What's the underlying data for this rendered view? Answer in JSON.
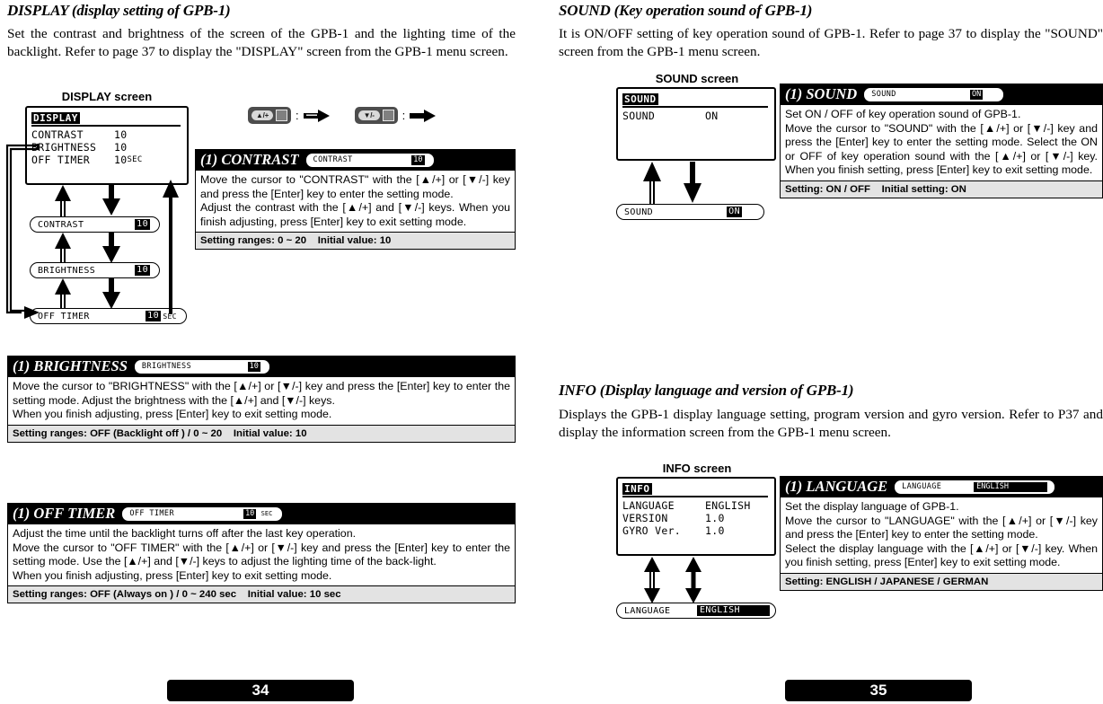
{
  "left_page": {
    "number": "34",
    "display_section": {
      "title": "DISPLAY (display setting of GPB-1)",
      "body": "Set the contrast and brightness of the screen of the GPB-1 and the lighting time of the backlight. Refer to page 37 to display the \"DISPLAY\" screen from the GPB-1 menu screen.",
      "screen_caption": "DISPLAY screen",
      "lcd": {
        "title": "DISPLAY",
        "rows": [
          {
            "label": "CONTRAST",
            "value": "10",
            "unit": ""
          },
          {
            "label": "BRIGHTNESS",
            "value": "10",
            "unit": ""
          },
          {
            "label": "OFF TIMER",
            "value": "10",
            "unit": "SEC"
          }
        ]
      },
      "flow_pills": [
        {
          "label": "CONTRAST",
          "value": "10",
          "suffix": ""
        },
        {
          "label": "BRIGHTNESS",
          "value": "10",
          "suffix": ""
        },
        {
          "label": "OFF TIMER",
          "value": "10",
          "suffix": "SEC"
        }
      ],
      "legend": [
        {
          "key": "/+",
          "arrow": "hollow-right-arrow",
          "colon": ":"
        },
        {
          "key": "/-",
          "arrow": "solid-right-arrow",
          "colon": ":"
        }
      ]
    },
    "cards": [
      {
        "title": "(1) CONTRAST",
        "chip": {
          "label": "CONTRAST",
          "value": "10",
          "suffix": ""
        },
        "paragraphs": [
          "Move the cursor to \"CONTRAST\" with the [▲/+] or [▼/-] key and press the [Enter] key to enter the setting mode.",
          "Adjust the contrast with the [▲/+] and [▼/-] keys. When you finish adjusting, press [Enter] key to exit setting mode."
        ],
        "footer": "Setting ranges: 0 ~ 20    Initial value: 10"
      },
      {
        "title": "(1) BRIGHTNESS",
        "chip": {
          "label": "BRIGHTNESS",
          "value": "10",
          "suffix": ""
        },
        "paragraphs": [
          "Move the cursor to \"BRIGHTNESS\" with the [▲/+] or [▼/-] key and press the [Enter] key to enter the setting mode. Adjust the brightness with the [▲/+] and [▼/-] keys.",
          "When you finish adjusting, press [Enter] key to exit setting mode."
        ],
        "footer": "Setting ranges: OFF (Backlight off ) / 0 ~ 20    Initial value: 10"
      },
      {
        "title": "(1) OFF TIMER",
        "chip": {
          "label": "OFF TIMER",
          "value": "10",
          "suffix": "SEC"
        },
        "paragraphs": [
          "Adjust the time until the backlight turns off after the last key operation.",
          "Move the cursor to \"OFF TIMER\" with the [▲/+] or [▼/-] key and press the [Enter] key to enter the setting mode. Use the [▲/+] and [▼/-] keys to adjust the lighting time of the back-light.",
          "When you finish adjusting, press [Enter] key to exit setting mode."
        ],
        "footer": "Setting ranges: OFF (Always on ) / 0 ~ 240 sec    Initial value: 10 sec"
      }
    ]
  },
  "right_page": {
    "number": "35",
    "sound_section": {
      "title": "SOUND (Key operation sound of GPB-1)",
      "body": "It is ON/OFF setting of key operation sound of GPB-1. Refer to page 37 to display the \"SOUND\" screen from the GPB-1 menu screen.",
      "screen_caption": "SOUND screen",
      "lcd": {
        "title": "SOUND",
        "rows": [
          {
            "label": "SOUND",
            "value": "ON",
            "unit": ""
          }
        ]
      },
      "flow_pills": [
        {
          "label": "SOUND",
          "value": "ON",
          "suffix": ""
        }
      ],
      "card": {
        "title": "(1) SOUND",
        "chip": {
          "label": "SOUND",
          "value": "ON",
          "suffix": ""
        },
        "paragraphs": [
          "Set ON / OFF of key operation sound of GPB-1.",
          "Move the cursor to \"SOUND\" with the [▲/+] or [▼/-] key and press the [Enter] key to enter the setting mode. Select the ON or OFF of key operation sound with the [▲/+] or [▼/-] key. When you finish setting, press [Enter] key to exit setting mode."
        ],
        "footer": "Setting: ON / OFF    Initial setting: ON"
      }
    },
    "info_section": {
      "title": "INFO (Display language and version of GPB-1)",
      "body": "Displays the GPB-1 display language setting, program version and gyro version. Refer to P37 and display the information screen from the GPB-1 menu screen.",
      "screen_caption": "INFO screen",
      "lcd": {
        "title": "INFO",
        "rows": [
          {
            "label": "LANGUAGE",
            "value": "ENGLISH",
            "unit": ""
          },
          {
            "label": "VERSION",
            "value": "1.0",
            "unit": ""
          },
          {
            "label": "GYRO Ver.",
            "value": "1.0",
            "unit": ""
          }
        ]
      },
      "flow_pills": [
        {
          "label": "LANGUAGE",
          "value": "ENGLISH",
          "suffix": ""
        }
      ],
      "card": {
        "title": "(1) LANGUAGE",
        "chip": {
          "label": "LANGUAGE",
          "value": "ENGLISH",
          "suffix": ""
        },
        "paragraphs": [
          "Set the display language of GPB-1.",
          "Move the cursor to \"LANGUAGE\" with the [▲/+] or [▼/-] key and press the [Enter] key to enter the setting mode.",
          "Select the display language with the [▲/+] or [▼/-] key. When you finish setting, press [Enter] key to exit setting mode."
        ],
        "footer": "Setting: ENGLISH / JAPANESE / GERMAN"
      }
    }
  }
}
